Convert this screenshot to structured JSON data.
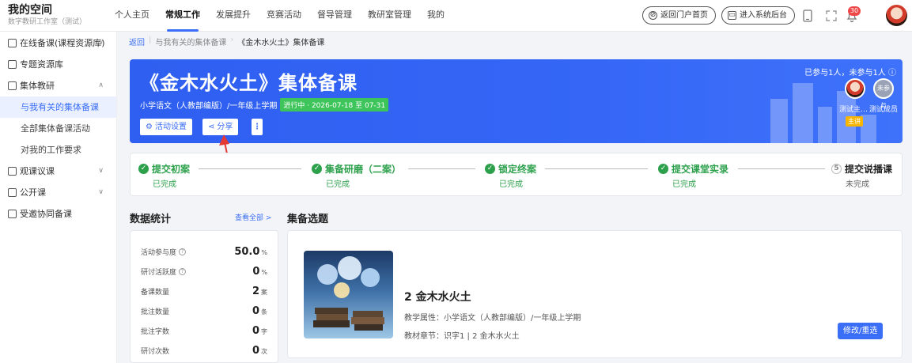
{
  "brand": {
    "title": "我的空间",
    "subtitle": "数字教研工作室（测试）"
  },
  "nav": {
    "items": [
      "个人主页",
      "常规工作",
      "发展提升",
      "竞赛活动",
      "督导管理",
      "教研室管理",
      "我的"
    ],
    "active_index": 1
  },
  "header_actions": {
    "portal": "返回门户首页",
    "system": "进入系统后台",
    "notification_count": "30"
  },
  "sidebar": {
    "item0": "在线备课(课程资源库)",
    "item1": "专题资源库",
    "item2": "集体教研",
    "sub0": "与我有关的集体备课",
    "sub1": "全部集体备课活动",
    "sub2": "对我的工作要求",
    "item3": "观课议课",
    "item4": "公开课",
    "item5": "受邀协同备课"
  },
  "breadcrumb": {
    "back": "返回",
    "parent": "与我有关的集体备课",
    "current": "《金木水火土》集体备课"
  },
  "banner": {
    "title": "《金木水火土》集体备课",
    "meta": "小学语文（人教部编版）/一年级上学期",
    "status": "进行中 · 2026-07-18 至 07-31",
    "btn_settings": "活动设置",
    "btn_share": "分享",
    "participation": "已参与1人，未参与1人",
    "member1_name": "测试主…",
    "member2_name": "测试成员",
    "member2_avatar": "未参与",
    "leader_tag": "主讲"
  },
  "steps": {
    "s1": {
      "label": "提交初案",
      "status": "已完成"
    },
    "s2": {
      "label": "集备研磨（二案）",
      "status": "已完成"
    },
    "s3": {
      "label": "锁定终案",
      "status": "已完成"
    },
    "s4": {
      "label": "提交课堂实录",
      "status": "已完成"
    },
    "s5": {
      "number": "5",
      "label": "提交说播课",
      "status": "未完成"
    }
  },
  "stats": {
    "title": "数据统计",
    "view_all": "查看全部 >",
    "rows": [
      {
        "label": "活动参与度",
        "value": "50.0",
        "unit": "%"
      },
      {
        "label": "研讨活跃度",
        "value": "0",
        "unit": "%"
      },
      {
        "label": "备课数量",
        "value": "2",
        "unit": "案"
      },
      {
        "label": "批注数量",
        "value": "0",
        "unit": "条"
      },
      {
        "label": "批注字数",
        "value": "0",
        "unit": "字"
      },
      {
        "label": "研讨次数",
        "value": "0",
        "unit": "次"
      }
    ]
  },
  "topic": {
    "title": "集备选题",
    "name": "2 金木水火土",
    "attr": "教学属性：小学语文（人教部编版）/一年级上学期",
    "chapter": "教材章节：识字1 | 2 金木水火土",
    "btn_modify": "修改/重选"
  },
  "colors": {
    "accent": "#3b6ef6",
    "banner": "#3566f6",
    "success": "#2da04c",
    "badge": "#f04848",
    "leader": "#f7b500"
  }
}
